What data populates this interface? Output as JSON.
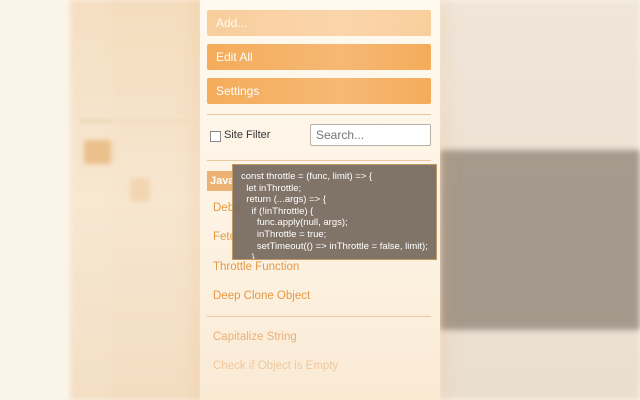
{
  "menu": {
    "add_label": "Add...",
    "edit_all_label": "Edit All",
    "settings_label": "Settings"
  },
  "filter": {
    "site_filter_label": "Site Filter",
    "search_placeholder": "Search..."
  },
  "category": {
    "label": "Java"
  },
  "snippets": [
    {
      "label": "Debo"
    },
    {
      "label": "Fetc"
    },
    {
      "label": "Throttle Function"
    },
    {
      "label": "Deep Clone Object"
    },
    {
      "label": "Capitalize String"
    },
    {
      "label": "Check if Object is Empty"
    }
  ],
  "tooltip": {
    "code_lines": [
      "const throttle = (func, limit) => {",
      "  let inThrottle;",
      "  return (...args) => {",
      "    if (!inThrottle) {",
      "      func.apply(null, args);",
      "      inThrottle = true;",
      "      setTimeout(() => inThrottle = false, limit);",
      "    }"
    ]
  },
  "colors": {
    "accent": "#f4ac5a",
    "link": "#e49a45",
    "tooltip_bg": "#6e6256"
  }
}
